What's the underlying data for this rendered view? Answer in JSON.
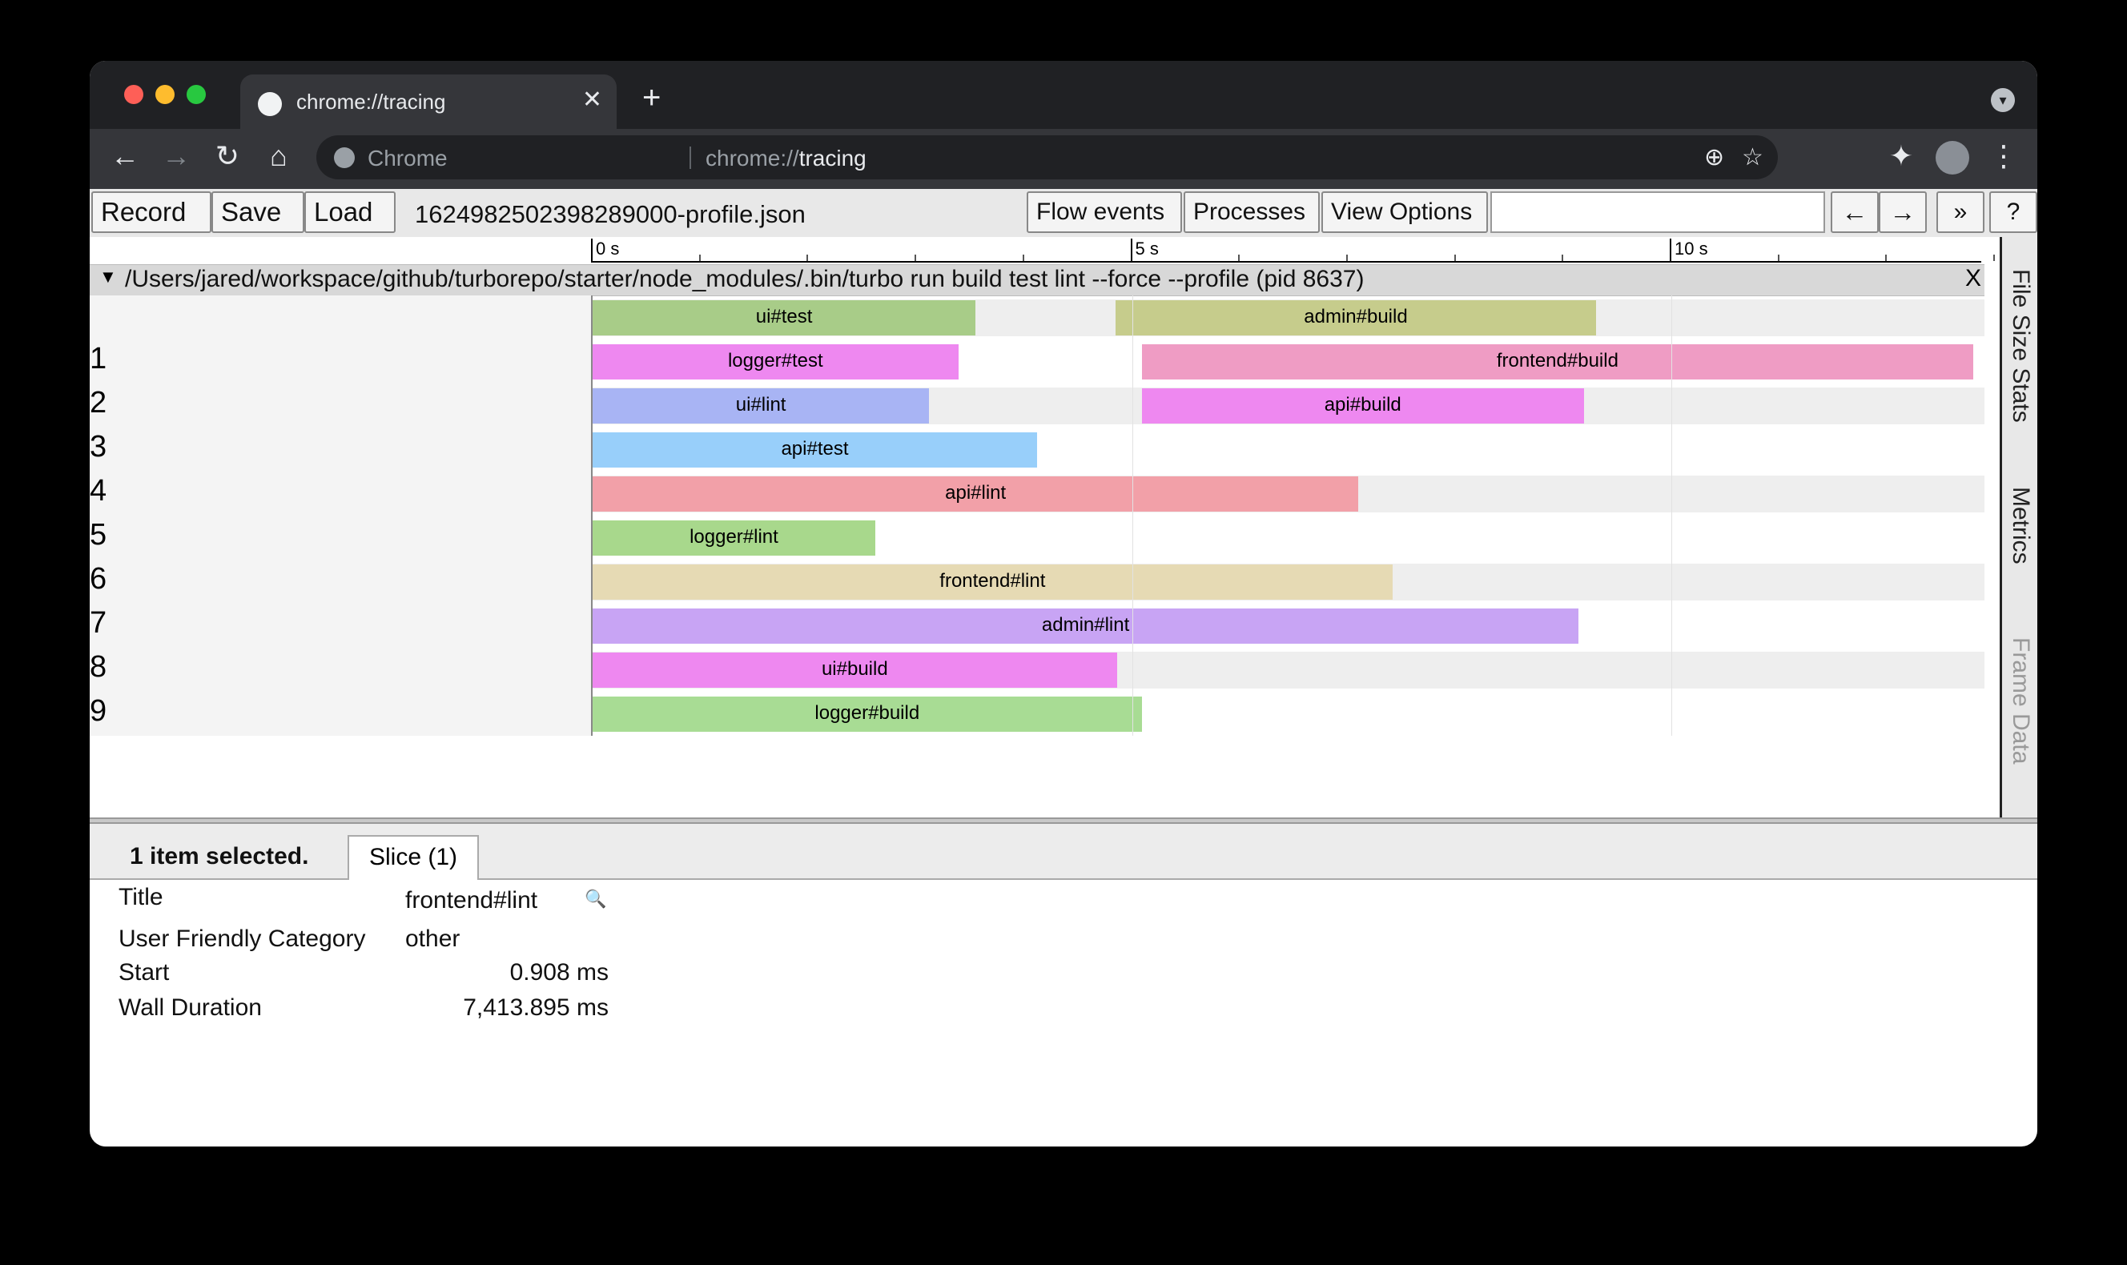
{
  "browser": {
    "tab_title": "chrome://tracing",
    "omnibox": {
      "site_label": "Chrome",
      "url_prefix": "chrome://",
      "url_host": "tracing"
    }
  },
  "trace_toolbar": {
    "record": "Record",
    "save": "Save",
    "load": "Load",
    "filename": "1624982502398289000-profile.json",
    "flow_events": "Flow events",
    "processes": "Processes",
    "view_options": "View Options",
    "prev": "←",
    "next": "→",
    "more": "»",
    "help": "?"
  },
  "ruler": {
    "labels": [
      "0 s",
      "5 s",
      "10 s"
    ]
  },
  "process": {
    "title": "/Users/jared/workspace/github/turborepo/starter/node_modules/.bin/turbo run build test lint --force --profile (pid 8637)",
    "close": "X"
  },
  "rows": [
    {
      "label": "",
      "slices": [
        {
          "name": "ui#test",
          "start_s": 0.0,
          "end_s": 3.55,
          "color": "#a8cc88"
        },
        {
          "name": "admin#build",
          "start_s": 4.85,
          "end_s": 9.3,
          "color": "#c6cc8c"
        }
      ]
    },
    {
      "label": "1",
      "slices": [
        {
          "name": "logger#test",
          "start_s": 0.0,
          "end_s": 3.39,
          "color": "#ee88f0"
        },
        {
          "name": "frontend#build",
          "start_s": 5.09,
          "end_s": 12.8,
          "color": "#ef9cc4"
        }
      ]
    },
    {
      "label": "2",
      "slices": [
        {
          "name": "ui#lint",
          "start_s": 0.0,
          "end_s": 3.12,
          "color": "#a8b4f4"
        },
        {
          "name": "api#build",
          "start_s": 5.09,
          "end_s": 9.19,
          "color": "#ee88f0"
        }
      ]
    },
    {
      "label": "3",
      "slices": [
        {
          "name": "api#test",
          "start_s": 0.0,
          "end_s": 4.12,
          "color": "#98cffa"
        }
      ]
    },
    {
      "label": "4",
      "slices": [
        {
          "name": "api#lint",
          "start_s": 0.0,
          "end_s": 7.1,
          "color": "#f2a0a8"
        }
      ]
    },
    {
      "label": "5",
      "slices": [
        {
          "name": "logger#lint",
          "start_s": 0.0,
          "end_s": 2.62,
          "color": "#a8d88c"
        }
      ]
    },
    {
      "label": "6",
      "slices": [
        {
          "name": "frontend#lint",
          "start_s": 0.0,
          "end_s": 7.414,
          "color": "#e6dab4"
        }
      ]
    },
    {
      "label": "7",
      "slices": [
        {
          "name": "admin#lint",
          "start_s": 0.0,
          "end_s": 9.14,
          "color": "#c8a4f4"
        }
      ]
    },
    {
      "label": "8",
      "slices": [
        {
          "name": "ui#build",
          "start_s": 0.0,
          "end_s": 4.86,
          "color": "#ee88f0"
        }
      ]
    },
    {
      "label": "9",
      "slices": [
        {
          "name": "logger#build",
          "start_s": 0.0,
          "end_s": 5.09,
          "color": "#a8dc94"
        }
      ]
    }
  ],
  "side_panel": {
    "file_size_stats": "File Size Stats",
    "metrics": "Metrics",
    "frame_data": "Frame Data"
  },
  "details": {
    "selected": "1 item selected.",
    "tab": "Slice (1)",
    "title_label": "Title",
    "title_value": "frontend#lint",
    "category_label": "User Friendly Category",
    "category_value": "other",
    "start_label": "Start",
    "start_value": "0.908 ms",
    "duration_label": "Wall Duration",
    "duration_value": "7,413.895 ms"
  }
}
